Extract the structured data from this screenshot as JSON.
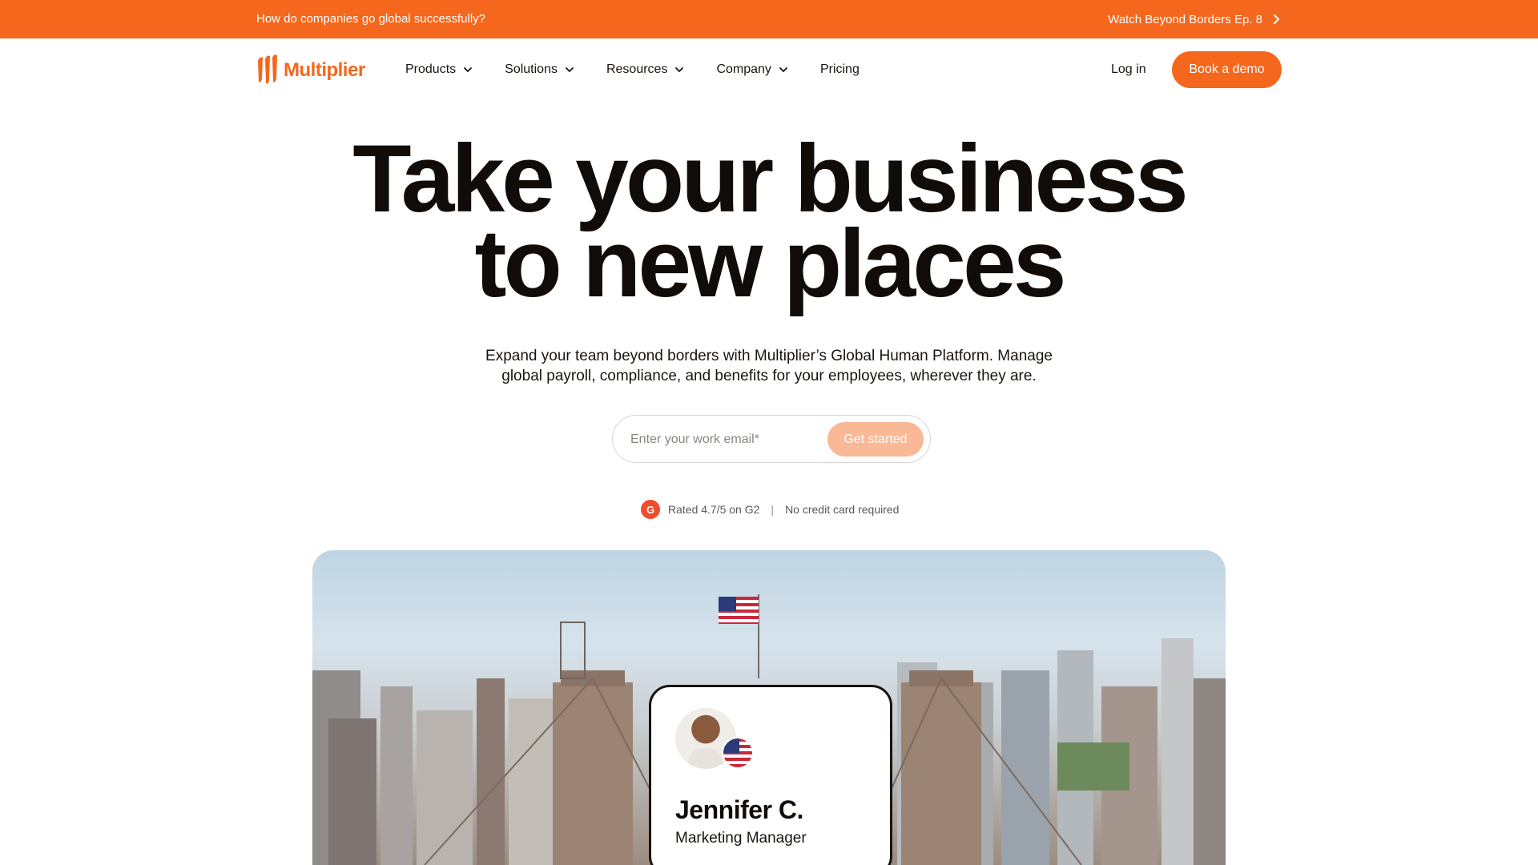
{
  "announcement": {
    "left_text": "How do companies go global successfully?",
    "right_text": "Watch Beyond Borders Ep. 8"
  },
  "brand": {
    "name": "Multiplier",
    "accent_color": "#f6671e"
  },
  "nav": {
    "items": [
      {
        "label": "Products",
        "has_dropdown": true
      },
      {
        "label": "Solutions",
        "has_dropdown": true
      },
      {
        "label": "Resources",
        "has_dropdown": true
      },
      {
        "label": "Company",
        "has_dropdown": true
      },
      {
        "label": "Pricing",
        "has_dropdown": false
      }
    ],
    "login": "Log in",
    "cta": "Book a demo"
  },
  "hero": {
    "headline_line1": "Take your business",
    "headline_line2": "to new places",
    "subtitle_line1": "Expand your team beyond borders with Multiplier’s Global Human Platform. Manage",
    "subtitle_line2": "global payroll, compliance, and benefits for your employees, wherever they are.",
    "email_placeholder": "Enter your work email*",
    "email_value": "",
    "submit_label": "Get started",
    "rating_badge": "G",
    "rating_text": "Rated 4.7/5 on G2",
    "rating_separator": "|",
    "no_card_text": "No credit card required"
  },
  "profile_card": {
    "name": "Jennifer C.",
    "role": "Marketing Manager",
    "flag_icon": "us-flag-icon"
  }
}
